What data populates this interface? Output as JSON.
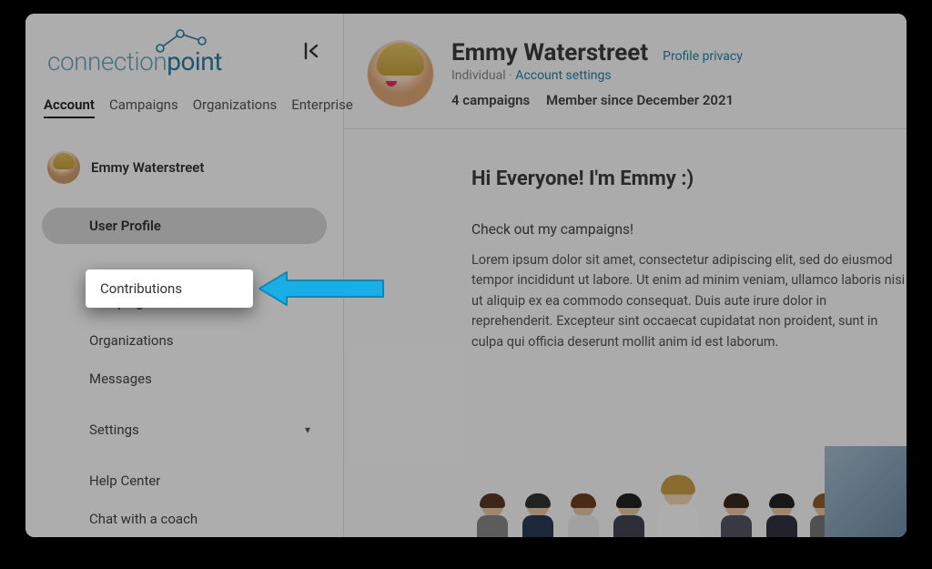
{
  "brand": {
    "name_light": "connection",
    "name_dark": "point"
  },
  "tabs": {
    "account": "Account",
    "campaigns": "Campaigns",
    "organizations": "Organizations",
    "enterprise": "Enterprise"
  },
  "sidebar_user": {
    "name": "Emmy Waterstreet"
  },
  "nav": {
    "user_profile": "User Profile",
    "contributions": "Contributions",
    "campaigns": "Campaigns",
    "organizations": "Organizations",
    "messages": "Messages",
    "settings": "Settings",
    "help_center": "Help Center",
    "chat_coach": "Chat with a coach"
  },
  "profile": {
    "name": "Emmy Waterstreet",
    "privacy_link": "Profile privacy",
    "type": "Individual",
    "settings_link": "Account settings",
    "stat_campaigns": "4 campaigns",
    "stat_member": "Member since December 2021"
  },
  "content": {
    "heading": "Hi Everyone! I'm Emmy :)",
    "lead": "Check out my campaigns!",
    "ipsum": "Lorem ipsum dolor sit amet, consectetur adipiscing elit, sed do eiusmod tempor incididunt ut labore. Ut enim ad minim veniam, ullamco laboris nisi ut aliquip ex ea commodo consequat. Duis aute irure dolor in reprehenderit. Excepteur sint occaecat cupidatat non proident, sunt in culpa qui officia deserunt mollit anim id est laborum."
  },
  "colors": {
    "accent": "#19aee5",
    "link": "#2a7fa6"
  }
}
